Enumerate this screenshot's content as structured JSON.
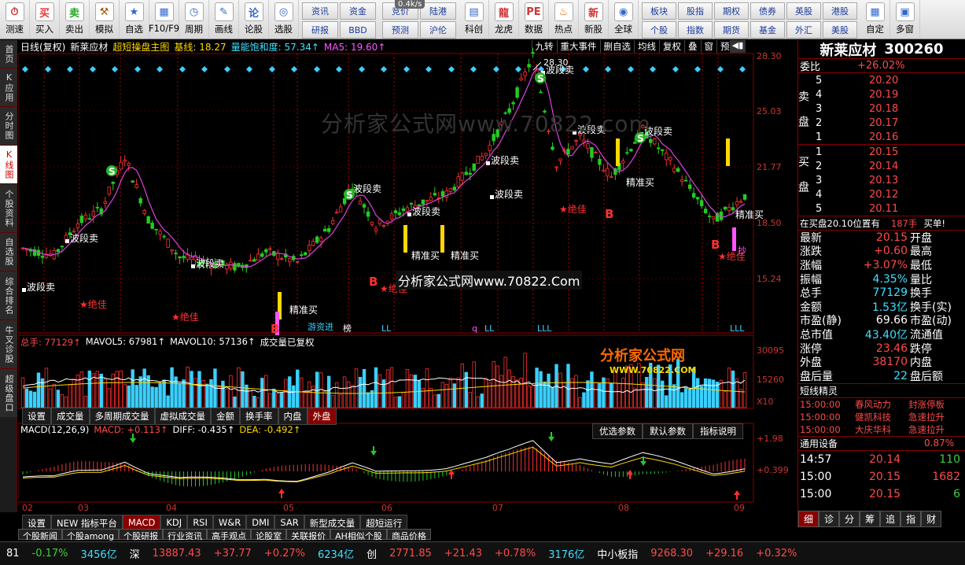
{
  "toolbar": {
    "buttons": [
      {
        "label": "测速",
        "icon": "clock-icon",
        "color": "#c33"
      },
      {
        "label": "买入",
        "icon": "buy-icon",
        "glyph": "买",
        "color": "#e33"
      },
      {
        "label": "卖出",
        "icon": "sell-icon",
        "glyph": "卖",
        "color": "#2a2"
      },
      {
        "label": "模拟",
        "icon": "hammer-icon",
        "glyph": "⚒",
        "color": "#a50"
      },
      {
        "label": "自选",
        "icon": "star-icon",
        "glyph": "★",
        "color": "#36c"
      },
      {
        "label": "F10/F9",
        "icon": "f10-icon",
        "glyph": "▦",
        "color": "#36c"
      },
      {
        "label": "周期",
        "icon": "period-icon",
        "glyph": "◷",
        "color": "#36c"
      },
      {
        "label": "画线",
        "icon": "pen-icon",
        "glyph": "✎",
        "color": "#36c"
      },
      {
        "label": "论股",
        "icon": "discuss-icon",
        "glyph": "论",
        "color": "#36c"
      },
      {
        "label": "选股",
        "icon": "select-stock-icon",
        "glyph": "◎",
        "color": "#36c"
      }
    ],
    "grid1": [
      "资讯",
      "资金",
      "研报",
      "BBD"
    ],
    "grid2": [
      "竞价",
      "陆港",
      "预测",
      "沪伦"
    ],
    "buttons2": [
      {
        "label": "科创",
        "icon": "kechuang-icon",
        "glyph": "▤",
        "color": "#36c"
      },
      {
        "label": "龙虎",
        "icon": "dragon-tiger-icon",
        "glyph": "龍",
        "color": "#c33"
      },
      {
        "label": "数据",
        "icon": "data-icon",
        "glyph": "PE",
        "color": "#c33"
      },
      {
        "label": "热点",
        "icon": "hot-icon",
        "glyph": "♨",
        "color": "#e60"
      },
      {
        "label": "新股",
        "icon": "new-stock-icon",
        "glyph": "新",
        "color": "#c33"
      },
      {
        "label": "全球",
        "icon": "globe-icon",
        "glyph": "◉",
        "color": "#36c"
      }
    ],
    "grid3": [
      "板块",
      "股指",
      "期权",
      "债券",
      "英股",
      "港股",
      "个股",
      "指数",
      "期货",
      "基金",
      "外汇",
      "美股"
    ],
    "buttons3": [
      {
        "label": "自定",
        "icon": "custom-icon",
        "glyph": "▦",
        "color": "#36c"
      },
      {
        "label": "多窗",
        "icon": "multi-window-icon",
        "glyph": "▣",
        "color": "#36c"
      }
    ],
    "version_badge": "0.4k/s"
  },
  "left_tabs": [
    "首页",
    "K应用",
    "分时图",
    "K线图",
    "个股资料",
    "自选股",
    "综合排名",
    "牛叉诊股",
    "超级盘口"
  ],
  "active_left_tab": "K线图",
  "info_line": {
    "period": "日线(复权)",
    "name": "新莱应材",
    "indicator": "超短操盘主图",
    "base_label": "基线: 18.27",
    "vol_sat": "量能饱和度: 57.34↑",
    "ma5": "MA5: 19.60↑"
  },
  "top_tools": [
    "九转",
    "重大事件",
    "删自选",
    "均线",
    "复权",
    "叠",
    "窗",
    "预测"
  ],
  "price_axis": [
    "28.30",
    "25.03",
    "21.77",
    "18.50",
    "15.24"
  ],
  "peak_label": "28.30",
  "annotations": {
    "sell": "波段卖",
    "jue": "★绝佳",
    "jingzhun": "精准买",
    "lll": "LLL",
    "ll": "LL",
    "q": "q",
    "bang": "榜",
    "chi": "抄",
    "s": "S",
    "b": "B",
    "youzi": "游资进"
  },
  "watermark": "分析家公式网www.70822.com",
  "watermark2": "分析家公式网www.70822.Com",
  "brand": "分析家公式网",
  "brand_url": "WWW.70822.COM",
  "volume_info": {
    "total": "总手: 77129↑",
    "mavol5": "MAVOL5: 67981↑",
    "mavol10": "MAVOL10: 57136↑",
    "note": "成交量已复权"
  },
  "volume_axis": [
    "30095",
    "15260",
    "X10"
  ],
  "sub_tabs": [
    "设置",
    "成交量",
    "多周期成交量",
    "虚拟成交量",
    "金额",
    "换手率",
    "内盘",
    "外盘"
  ],
  "active_sub_tab": "外盘",
  "macd_info": {
    "name": "MACD(12,26,9)",
    "macd": "MACD: +0.113↑",
    "diff": "DIFF: -0.435↑",
    "dea": "DEA: -0.492↑"
  },
  "macd_buttons": [
    "优选参数",
    "默认参数",
    "指标说明"
  ],
  "macd_axis": [
    "+1.98",
    "+0.399"
  ],
  "date_axis": [
    "02",
    "03",
    "04",
    "05",
    "06",
    "07",
    "08",
    "09"
  ],
  "indicator_tabs": [
    "设置",
    "NEW 指标平台",
    "MACD",
    "KDJ",
    "RSI",
    "W&R",
    "DMI",
    "SAR",
    "新型成交量",
    "超短运行"
  ],
  "active_indicator_tab": "MACD",
  "bottom_links": [
    "个股新闻",
    "个股among",
    "个股研报",
    "行业资讯",
    "高手观点",
    "论股室",
    "关联报价",
    "AH相似个股",
    "商品价格"
  ],
  "right_panel": {
    "stock_name": "新莱应材",
    "stock_code": "300260",
    "weibi_label": "委比",
    "weibi_value": "+26.02%",
    "sell_label": "卖盘",
    "buy_label": "买盘",
    "asks": [
      {
        "level": "5",
        "price": "20.20"
      },
      {
        "level": "4",
        "price": "20.19"
      },
      {
        "level": "3",
        "price": "20.18"
      },
      {
        "level": "2",
        "price": "20.17"
      },
      {
        "level": "1",
        "price": "20.16"
      }
    ],
    "bids": [
      {
        "level": "1",
        "price": "20.15"
      },
      {
        "level": "2",
        "price": "20.14"
      },
      {
        "level": "3",
        "price": "20.13"
      },
      {
        "level": "4",
        "price": "20.12"
      },
      {
        "level": "5",
        "price": "20.11"
      }
    ],
    "buy_notice": "在买盘20.10位置有",
    "buy_notice_qty": "187手",
    "buy_notice_tag": "买单!",
    "stats": [
      {
        "l": "最新",
        "v": "20.15",
        "l2": "开盘",
        "vc": "red"
      },
      {
        "l": "涨跌",
        "v": "+0.60",
        "l2": "最高",
        "vc": "red"
      },
      {
        "l": "涨幅",
        "v": "+3.07%",
        "l2": "最低",
        "vc": "red"
      },
      {
        "l": "振幅",
        "v": "4.35%",
        "l2": "量比",
        "vc": "cyan"
      },
      {
        "l": "总手",
        "v": "77129",
        "l2": "换手",
        "vc": "cyan"
      },
      {
        "l": "金额",
        "v": "1.53亿",
        "l2": "换手(实)",
        "vc": "cyan"
      },
      {
        "l": "市盈(静)",
        "v": "69.66",
        "l2": "市盈(动)",
        "vc": "white"
      },
      {
        "l": "总市值",
        "v": "43.40亿",
        "l2": "流通值",
        "vc": "cyan"
      },
      {
        "l": "涨停",
        "v": "23.46",
        "l2": "跌停",
        "vc": "red"
      },
      {
        "l": "外盘",
        "v": "38170",
        "l2": "内盘",
        "vc": "red"
      },
      {
        "l": "盘后量",
        "v": "22",
        "l2": "盘后额",
        "vc": "cyan"
      }
    ],
    "sprite_title": "短线精灵",
    "sprites": [
      {
        "time": "15:00:00",
        "name": "春风动力",
        "event": "封涨停板"
      },
      {
        "time": "15:00:00",
        "name": "健凯科技",
        "event": "急速拉升"
      },
      {
        "time": "15:00:00",
        "name": "大庆华科",
        "event": "急速拉升"
      }
    ],
    "general_label": "通用设备",
    "general_value": "0.87%",
    "ticks": [
      {
        "time": "14:57",
        "price": "20.14",
        "vol": "110",
        "dir": "green"
      },
      {
        "time": "15:00",
        "price": "20.15",
        "vol": "1682",
        "dir": "red"
      },
      {
        "time": "15:00",
        "price": "20.15",
        "vol": "6",
        "dir": "green"
      }
    ],
    "bottom_tabs": [
      "细",
      "诊",
      "分",
      "筹",
      "追",
      "指",
      "财"
    ]
  },
  "status_bar": [
    {
      "t": "81",
      "c": "white"
    },
    {
      "t": "-0.17%",
      "c": "green"
    },
    {
      "t": "3456亿",
      "c": "cyan"
    },
    {
      "t": "深",
      "c": "white"
    },
    {
      "t": "13887.43",
      "c": "red"
    },
    {
      "t": "+37.77",
      "c": "red"
    },
    {
      "t": "+0.27%",
      "c": "red"
    },
    {
      "t": "6234亿",
      "c": "cyan"
    },
    {
      "t": "创",
      "c": "white"
    },
    {
      "t": "2771.85",
      "c": "red"
    },
    {
      "t": "+21.43",
      "c": "red"
    },
    {
      "t": "+0.78%",
      "c": "red"
    },
    {
      "t": "3176亿",
      "c": "cyan"
    },
    {
      "t": "中小板指",
      "c": "white"
    },
    {
      "t": "9268.30",
      "c": "red"
    },
    {
      "t": "+29.16",
      "c": "red"
    },
    {
      "t": "+0.32%",
      "c": "red"
    }
  ],
  "colors": {
    "up": "#ff3030",
    "down": "#30d0d0",
    "green_candle": "#22cc22",
    "bg": "#000000",
    "grid": "#800000"
  }
}
